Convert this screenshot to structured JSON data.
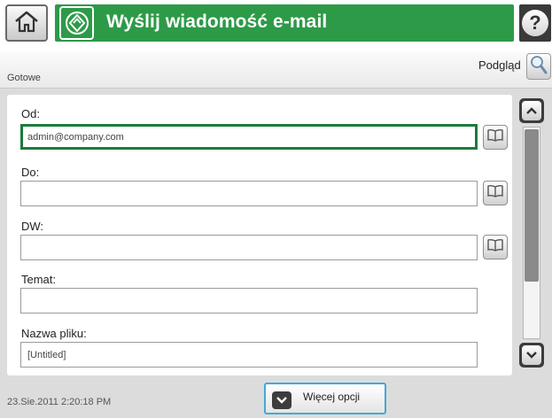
{
  "header": {
    "title": "Wyślij wiadomość e-mail",
    "home_icon": "home-icon",
    "title_icon": "send-email-icon",
    "help_glyph": "?",
    "accent_color": "#2d9a48"
  },
  "status": {
    "text": "Gotowe",
    "preview_label": "Podgląd",
    "preview_icon": "magnifier-icon"
  },
  "form": {
    "from": {
      "label": "Od:",
      "value": "admin@company.com"
    },
    "to": {
      "label": "Do:",
      "value": ""
    },
    "cc": {
      "label": "DW:",
      "value": ""
    },
    "subject": {
      "label": "Temat:",
      "value": ""
    },
    "filename": {
      "label": "Nazwa pliku:",
      "value": "[Untitled]"
    },
    "address_book_icon": "address-book-icon"
  },
  "footer": {
    "datetime": "23.Sie.2011 2:20:18 PM",
    "more_options_label": "Więcej opcji"
  }
}
